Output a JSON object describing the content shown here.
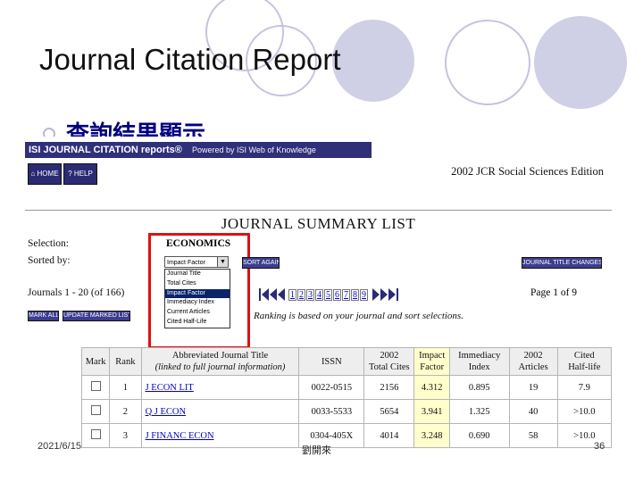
{
  "slide": {
    "title": "Journal Citation Report",
    "subtitle": "查詢結果顯示"
  },
  "header": {
    "brand": "ISI JOURNAL CITATION reports®",
    "powered_by": "Powered by ISI Web of Knowledge",
    "home_label": "HOME",
    "help_label": "HELP",
    "edition": "2002 JCR Social Sciences Edition"
  },
  "summary": {
    "title": "JOURNAL SUMMARY LIST",
    "selection_label": "Selection:",
    "selection_value": "ECONOMICS",
    "sorted_by_label": "Sorted by:",
    "sort_selected": "Impact Factor",
    "sort_options": [
      "Journal Title",
      "Total Cites",
      "Impact Factor",
      "Immediacy Index",
      "Current Articles",
      "Cited Half-Life"
    ],
    "sort_again_label": "SORT AGAIN",
    "title_changes_label": "JOURNAL TITLE CHANGES",
    "journals_range": "Journals 1 - 20 (of 166)",
    "mark_all_label": "MARK ALL",
    "update_marked_label": "UPDATE MARKED LIST",
    "pages": [
      "1",
      "2",
      "3",
      "4",
      "5",
      "6",
      "7",
      "8",
      "9"
    ],
    "page_of": "Page 1 of 9",
    "ranking_note": "Ranking is based on your journal and sort selections."
  },
  "table": {
    "headers": {
      "mark": "Mark",
      "rank": "Rank",
      "title_line1": "Abbreviated Journal Title",
      "title_line2": "(linked to full journal information)",
      "issn": "ISSN",
      "total_cites_1": "2002",
      "total_cites_2": "Total Cites",
      "impact_1": "Impact",
      "impact_2": "Factor",
      "immediacy_1": "Immediacy",
      "immediacy_2": "Index",
      "articles_1": "2002",
      "articles_2": "Articles",
      "halflife_1": "Cited",
      "halflife_2": "Half-life"
    },
    "rows": [
      {
        "rank": "1",
        "title": "J ECON LIT",
        "issn": "0022-0515",
        "total_cites": "2156",
        "impact_factor": "4.312",
        "immediacy": "0.895",
        "articles": "19",
        "half_life": "7.9"
      },
      {
        "rank": "2",
        "title": "Q J ECON",
        "issn": "0033-5533",
        "total_cites": "5654",
        "impact_factor": "3.941",
        "immediacy": "1.325",
        "articles": "40",
        "half_life": ">10.0"
      },
      {
        "rank": "3",
        "title": "J FINANC ECON",
        "issn": "0304-405X",
        "total_cites": "4014",
        "impact_factor": "3.248",
        "immediacy": "0.690",
        "articles": "58",
        "half_life": ">10.0"
      }
    ]
  },
  "footer": {
    "date": "2021/6/15",
    "center": "劉開來",
    "page": "36"
  },
  "colors": {
    "isi_bar": "#2f2f7a",
    "highlight_box": "#e01010",
    "impact_column": "#ffffcc",
    "decor_circles": "#cfcfe6"
  }
}
